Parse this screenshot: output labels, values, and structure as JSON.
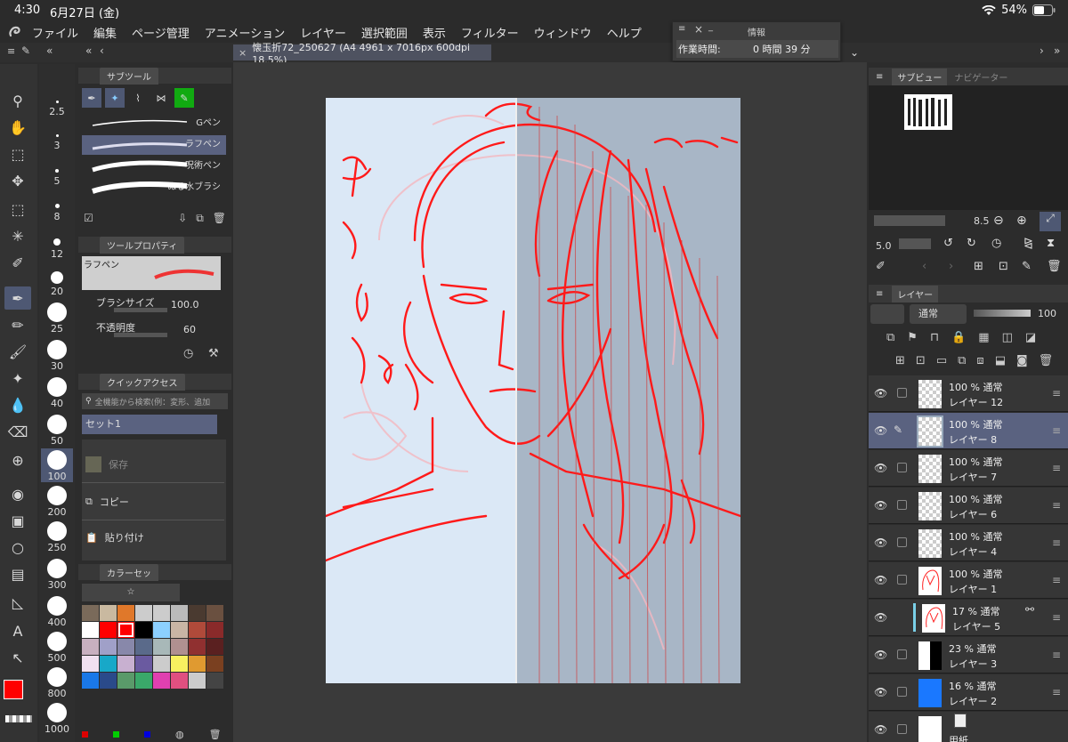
{
  "status": {
    "time": "4:30",
    "date": "6月27日 (金)",
    "battery": "54%"
  },
  "menu": [
    "ファイル",
    "編集",
    "ページ管理",
    "アニメーション",
    "レイヤー",
    "選択範囲",
    "表示",
    "フィルター",
    "ウィンドウ",
    "ヘルプ"
  ],
  "document_tab": "懐玉折72_250627 (A4 4961 x 7016px 600dpi 18.5%)",
  "info_panel": {
    "title": "情報",
    "label": "作業時間:",
    "value": "0 時間 39 分"
  },
  "subtool": {
    "title": "サブツール",
    "brushes": [
      "Gペン",
      "ラフペン",
      "呪術ペン",
      "ぬる水ブラシ"
    ],
    "selected": "ラフペン"
  },
  "tool_property": {
    "title": "ツールプロパティ",
    "preset_name": "ラフペン",
    "brush_size_label": "ブラシサイズ",
    "brush_size_value": "100.0",
    "opacity_label": "不透明度",
    "opacity_value": "60"
  },
  "quick_access": {
    "title": "クイックアクセス",
    "search_placeholder": "全機能から検索(例：変形、追加",
    "set_name": "セット1",
    "items": [
      "保存",
      "コピー",
      "貼り付け"
    ]
  },
  "color_set": {
    "title": "カラーセッ",
    "selector": "☆"
  },
  "brush_sizes": [
    "2.5",
    "3",
    "5",
    "8",
    "12",
    "20",
    "25",
    "30",
    "40",
    "50",
    "100",
    "200",
    "250",
    "300",
    "400",
    "500",
    "800",
    "1000"
  ],
  "selected_size": "100",
  "sub_view": {
    "tab1": "サブビュー",
    "tab2": "ナビゲーター"
  },
  "navigator": {
    "zoom": "8.5",
    "rotation": "5.0"
  },
  "layer_panel": {
    "title": "レイヤー",
    "blend_mode": "通常",
    "opacity": "100"
  },
  "layers": [
    {
      "opacity": "100 %",
      "mode": "通常",
      "name": "レイヤー 12",
      "selected": false
    },
    {
      "opacity": "100 %",
      "mode": "通常",
      "name": "レイヤー 8",
      "selected": true
    },
    {
      "opacity": "100 %",
      "mode": "通常",
      "name": "レイヤー 7",
      "selected": false
    },
    {
      "opacity": "100 %",
      "mode": "通常",
      "name": "レイヤー 6",
      "selected": false
    },
    {
      "opacity": "100 %",
      "mode": "通常",
      "name": "レイヤー 4",
      "selected": false
    },
    {
      "opacity": "100 %",
      "mode": "通常",
      "name": "レイヤー 1",
      "selected": false
    },
    {
      "opacity": "17 %",
      "mode": "通常",
      "name": "レイヤー 5",
      "selected": false
    },
    {
      "opacity": "23 %",
      "mode": "通常",
      "name": "レイヤー 3",
      "selected": false
    },
    {
      "opacity": "16 %",
      "mode": "通常",
      "name": "レイヤー 2",
      "selected": false
    },
    {
      "opacity": "",
      "mode": "",
      "name": "用紙",
      "selected": false
    }
  ],
  "colors": {
    "main": "#ff0000",
    "accent": "#5a6280",
    "paper_bg": "#dbe8f6",
    "sketch": "#ff1a1a"
  }
}
